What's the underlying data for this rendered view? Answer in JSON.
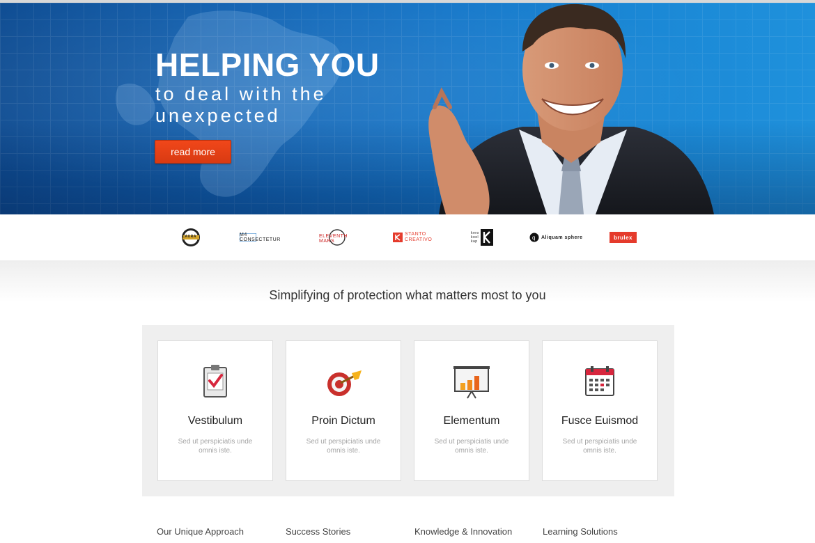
{
  "hero": {
    "title": "HELPING YOU",
    "subtitle": "to deal with the unexpected",
    "button_label": "read more"
  },
  "logos": [
    {
      "name": "LAURA",
      "icon": "badge-icon"
    },
    {
      "name": "M4 CONSECTETUR",
      "icon": "m4-logo"
    },
    {
      "name": "ELEVENTH MARS",
      "icon": "circle-logo"
    },
    {
      "name": "STANTO CREATIVO",
      "icon": "k-logo"
    },
    {
      "name": "K",
      "icon": "k-block-logo"
    },
    {
      "name": "Aliquam sphere",
      "icon": "q-logo"
    },
    {
      "name": "brulex",
      "icon": "brulex-logo"
    }
  ],
  "headline": "Simplifying of protection what matters most to you",
  "features": [
    {
      "title": "Vestibulum",
      "desc": "Sed ut perspiciatis unde omnis iste.",
      "icon": "clipboard-check-icon"
    },
    {
      "title": "Proin Dictum",
      "desc": "Sed ut perspiciatis unde omnis iste.",
      "icon": "target-dart-icon"
    },
    {
      "title": "Elementum",
      "desc": "Sed ut perspiciatis unde omnis iste.",
      "icon": "presentation-chart-icon"
    },
    {
      "title": "Fusce Euismod",
      "desc": "Sed ut perspiciatis unde omnis iste.",
      "icon": "calendar-icon"
    }
  ],
  "footer_nav": [
    "Our Unique Approach",
    "Success Stories",
    "Knowledge & Innovation",
    "Learning Solutions"
  ],
  "colors": {
    "hero_blue": "#1677c9",
    "button_orange": "#e4411a",
    "panel_gray": "#efefef"
  }
}
